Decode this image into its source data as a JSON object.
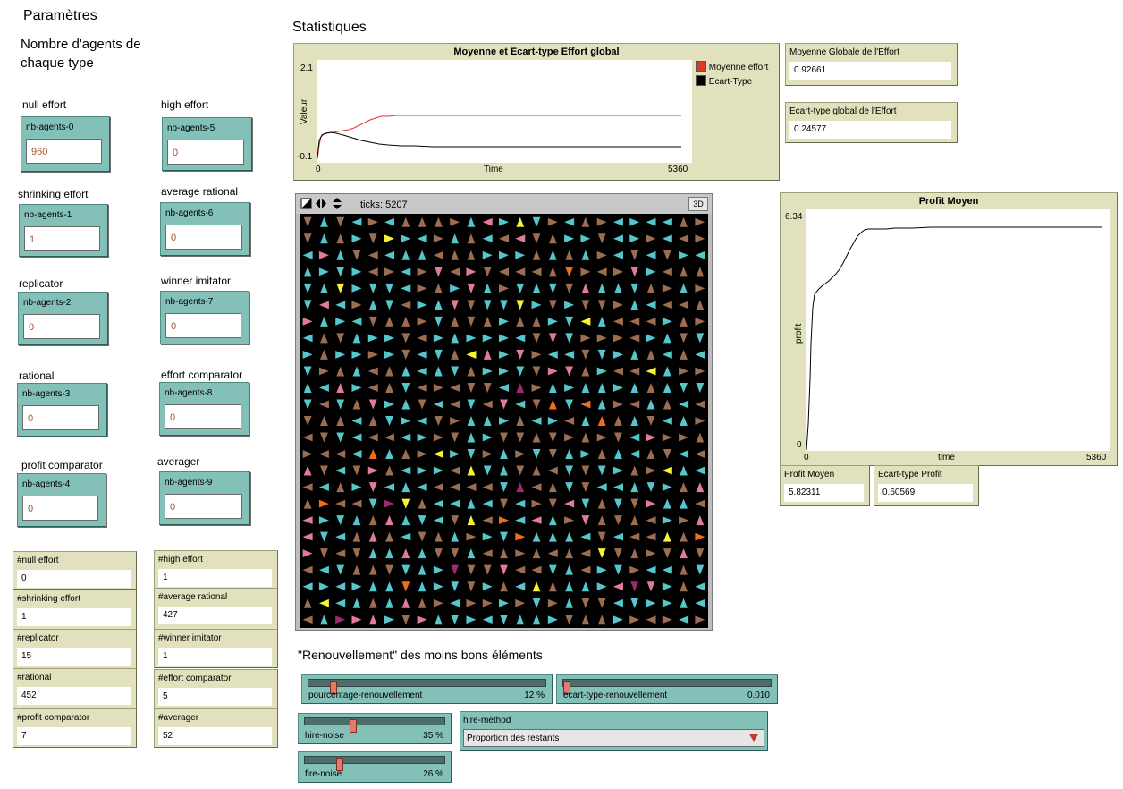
{
  "parametres": {
    "title": "Paramètres",
    "subtitle_line1": "Nombre d'agents de",
    "subtitle_line2": "chaque type",
    "inputs": [
      {
        "caption": "null effort",
        "name": "nb-agents-0",
        "value": "960"
      },
      {
        "caption": "high effort",
        "name": "nb-agents-5",
        "value": "0"
      },
      {
        "caption": "shrinking effort",
        "name": "nb-agents-1",
        "value": "1"
      },
      {
        "caption": "average rational",
        "name": "nb-agents-6",
        "value": "0"
      },
      {
        "caption": "replicator",
        "name": "nb-agents-2",
        "value": "0"
      },
      {
        "caption": "winner imitator",
        "name": "nb-agents-7",
        "value": "0"
      },
      {
        "caption": "rational",
        "name": "nb-agents-3",
        "value": "0"
      },
      {
        "caption": "effort comparator",
        "name": "nb-agents-8",
        "value": "0"
      },
      {
        "caption": "profit comparator",
        "name": "nb-agents-4",
        "value": "0"
      },
      {
        "caption": "averager",
        "name": "nb-agents-9",
        "value": "0"
      }
    ]
  },
  "counters": [
    {
      "label": "#null effort",
      "value": "0"
    },
    {
      "label": "#high effort",
      "value": "1"
    },
    {
      "label": "#shrinking effort",
      "value": "1"
    },
    {
      "label": "#average rational",
      "value": "427"
    },
    {
      "label": "#replicator",
      "value": "15"
    },
    {
      "label": "#winner imitator",
      "value": "1"
    },
    {
      "label": "#rational",
      "value": "452"
    },
    {
      "label": "#effort comparator",
      "value": "5"
    },
    {
      "label": "#profit comparator",
      "value": "7"
    },
    {
      "label": "#averager",
      "value": "52"
    }
  ],
  "stats": {
    "title": "Statistiques",
    "plot1": {
      "title": "Moyenne et Ecart-type Effort global",
      "ylabel": "Valeur",
      "xlabel": "Time",
      "ymax": "2.1",
      "ymin": "-0.1",
      "xmin": "0",
      "xmax": "5360",
      "legend": [
        {
          "name": "Moyenne effort",
          "color": "#d73a2f"
        },
        {
          "name": "Ecart-Type",
          "color": "#000000"
        }
      ]
    },
    "mean_effort": {
      "label": "Moyenne Globale de l'Effort",
      "value": "0.92661"
    },
    "std_effort": {
      "label": "Ecart-type global de l'Effort",
      "value": "0.24577"
    },
    "plot2": {
      "title": "Profit Moyen",
      "ylabel": "profit",
      "xlabel": "time",
      "ymax": "6.34",
      "ymin": "0",
      "xmin": "0",
      "xmax": "5360"
    },
    "profit_mean": {
      "label": "Profit Moyen",
      "value": "5.82311"
    },
    "profit_std": {
      "label": "Ecart-type Profit",
      "value": "0.60569"
    }
  },
  "view": {
    "ticks": "ticks: 5207",
    "btn3d": "3D"
  },
  "renouvellement": {
    "title": "\"Renouvellement\" des moins bons éléments",
    "sliders": [
      {
        "label": "pourcentage-renouvellement",
        "value": "12 %",
        "level": 0.12
      },
      {
        "label": "ecart-type-renouvellement",
        "value": "0.010",
        "level": 0.01
      },
      {
        "label": "hire-noise",
        "value": "35 %",
        "level": 0.35
      },
      {
        "label": "fire-noise",
        "value": "26 %",
        "level": 0.26
      }
    ],
    "chooser": {
      "label": "hire-method",
      "value": "Proportion des restants"
    }
  },
  "colors": {
    "input_bg": "#82c0b8",
    "monitor_bg": "#e1e1bd",
    "turtle_cyan": "#54c6cc",
    "turtle_brown": "#9c6d4f",
    "turtle_pink": "#e07b9a"
  }
}
